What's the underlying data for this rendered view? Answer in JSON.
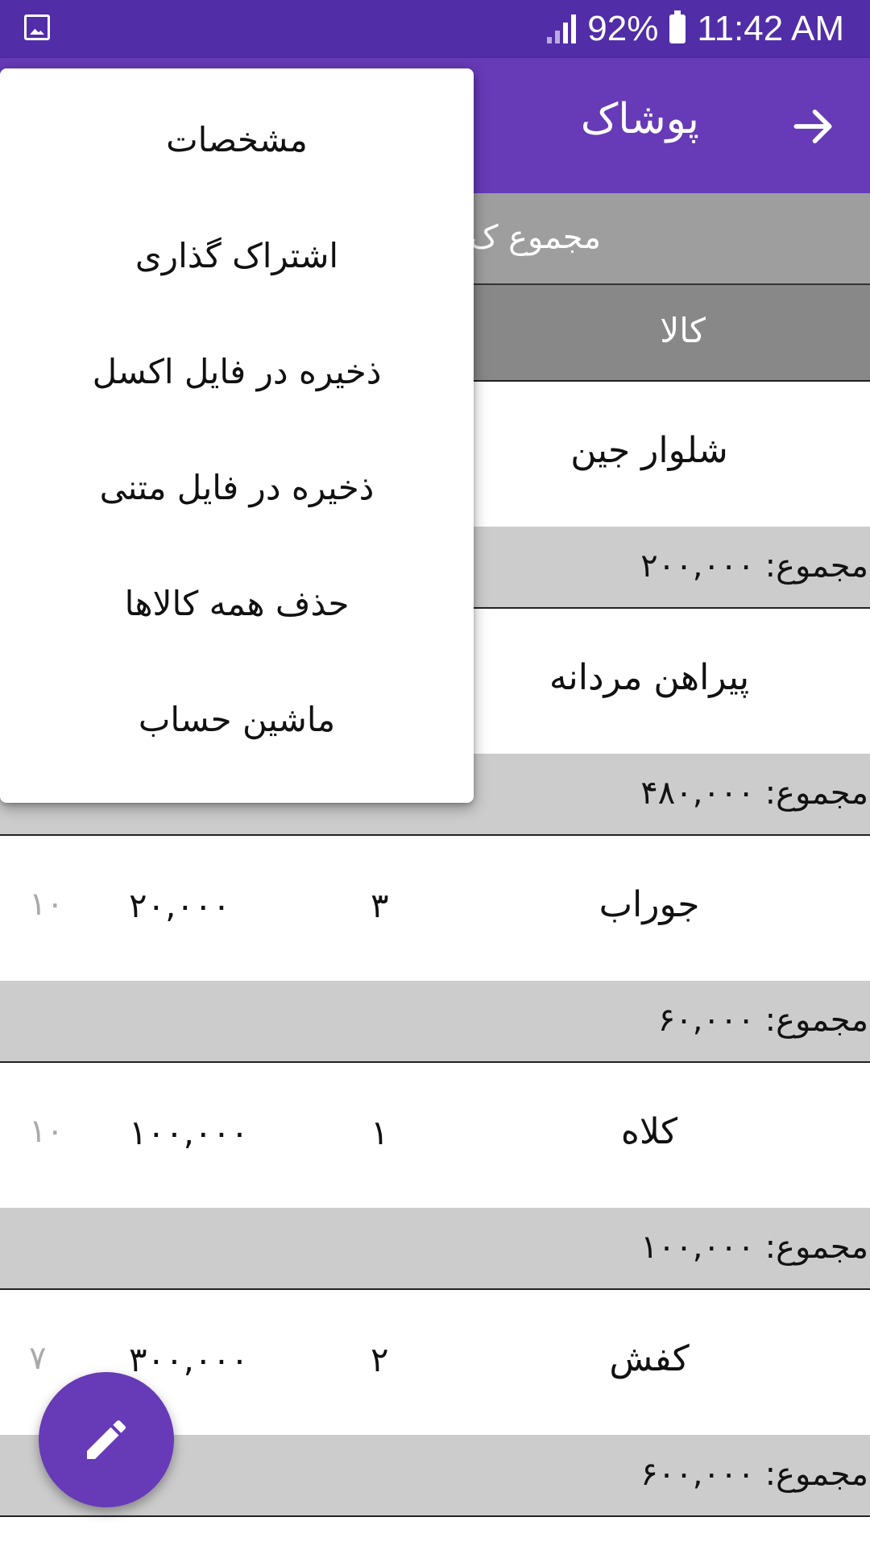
{
  "status_bar": {
    "battery": "92%",
    "time": "11:42 AM",
    "icons": [
      "gallery-icon",
      "signal-icon",
      "battery-icon"
    ]
  },
  "app_bar": {
    "title": "پوشاک",
    "back_icon": "arrow-right-icon",
    "color": "#673ab7"
  },
  "summary": {
    "label": "مجموع ک"
  },
  "table_header": {
    "item": "کالا"
  },
  "rows": [
    {
      "name": "شلوار جین",
      "qty": "",
      "price": "",
      "extra": "",
      "total": "مجموع: ۲۰۰,۰۰۰"
    },
    {
      "name": "پیراهن مردانه",
      "qty": "",
      "price": "",
      "extra": "",
      "total": "مجموع: ۴۸۰,۰۰۰"
    },
    {
      "name": "جوراب",
      "qty": "۳",
      "price": "۲۰,۰۰۰",
      "extra": "۱۰",
      "total": "مجموع: ۶۰,۰۰۰"
    },
    {
      "name": "کلاه",
      "qty": "۱",
      "price": "۱۰۰,۰۰۰",
      "extra": "۱۰",
      "total": "مجموع: ۱۰۰,۰۰۰"
    },
    {
      "name": "کفش",
      "qty": "۲",
      "price": "۳۰۰,۰۰۰",
      "extra": "۷",
      "total": "مجموع: ۶۰۰,۰۰۰"
    }
  ],
  "menu": {
    "items": [
      "مشخصات",
      "اشتراک گذاری",
      "ذخیره در فایل اکسل",
      "ذخیره در فایل متنی",
      "حذف همه کالاها",
      "ماشین حساب"
    ]
  },
  "fab": {
    "icon": "pencil-icon"
  }
}
